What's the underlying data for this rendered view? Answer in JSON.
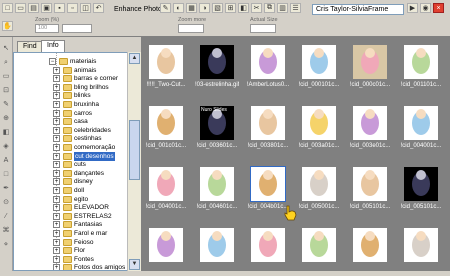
{
  "toolbar": {
    "enhance_label": "Enhance Photo",
    "browser_combo_value": "Cris Taylor-SilviaFrame",
    "zoom_group_label": "Zoom (%)",
    "zoom_value": "100",
    "actual_size_label": "Actual Size",
    "zoom_more_label": "Zoom more"
  },
  "sidebar": {
    "tabs": [
      "Find",
      "Info"
    ],
    "active_tab": "Info",
    "folders": [
      {
        "label": "materiais",
        "expanded": true,
        "selected": false
      },
      {
        "label": "animais",
        "expanded": false,
        "selected": false
      },
      {
        "label": "barras e corner",
        "expanded": false,
        "selected": false
      },
      {
        "label": "bling brilhos",
        "expanded": false,
        "selected": false
      },
      {
        "label": "blinks",
        "expanded": false,
        "selected": false
      },
      {
        "label": "bruxinha",
        "expanded": false,
        "selected": false
      },
      {
        "label": "carros",
        "expanded": false,
        "selected": false
      },
      {
        "label": "casa",
        "expanded": false,
        "selected": false
      },
      {
        "label": "celebridades",
        "expanded": false,
        "selected": false
      },
      {
        "label": "cestinhas",
        "expanded": false,
        "selected": false
      },
      {
        "label": "comemoração",
        "expanded": false,
        "selected": false
      },
      {
        "label": "cut desenhos",
        "expanded": false,
        "selected": true
      },
      {
        "label": "cuts",
        "expanded": false,
        "selected": false
      },
      {
        "label": "dançantes",
        "expanded": false,
        "selected": false
      },
      {
        "label": "disney",
        "expanded": false,
        "selected": false
      },
      {
        "label": "doll",
        "expanded": false,
        "selected": false
      },
      {
        "label": "egito",
        "expanded": false,
        "selected": false
      },
      {
        "label": "ELEVADOR",
        "expanded": false,
        "selected": false
      },
      {
        "label": "ESTRELAS2",
        "expanded": false,
        "selected": false
      },
      {
        "label": "Fantasias",
        "expanded": false,
        "selected": false
      },
      {
        "label": "Farol e mar",
        "expanded": false,
        "selected": false
      },
      {
        "label": "Feioso",
        "expanded": false,
        "selected": false
      },
      {
        "label": "Flor",
        "expanded": false,
        "selected": false
      },
      {
        "label": "Fontes",
        "expanded": false,
        "selected": false
      },
      {
        "label": "Fotos dos amigos",
        "expanded": false,
        "selected": false
      }
    ]
  },
  "gallery": {
    "items": [
      {
        "caption": "!!!!!_Two-Cut...",
        "tone": "light"
      },
      {
        "caption": "!03-estrelinha.gif",
        "tone": "dark"
      },
      {
        "caption": "!AmberLotus0...",
        "tone": "light"
      },
      {
        "caption": "!cid_000101c...",
        "tone": "light"
      },
      {
        "caption": "!cid_000c01c...",
        "tone": "tan"
      },
      {
        "caption": "!cid_001101c...",
        "tone": "light"
      },
      {
        "caption": "!cid_001c01c...",
        "tone": "light"
      },
      {
        "caption": "!cid_003601c...",
        "tone": "dark"
      },
      {
        "caption": "!cid_003801c...",
        "tone": "light"
      },
      {
        "caption": "!cid_003a01c...",
        "tone": "light"
      },
      {
        "caption": "!cid_003e01c...",
        "tone": "light"
      },
      {
        "caption": "!cid_004001c...",
        "tone": "light"
      },
      {
        "caption": "!cid_004001c...",
        "tone": "light"
      },
      {
        "caption": "!cid_004601c...",
        "tone": "light"
      },
      {
        "caption": "!cid_004b01c...",
        "tone": "light"
      },
      {
        "caption": "!cid_005001c...",
        "tone": "light"
      },
      {
        "caption": "!cid_005101c...",
        "tone": "light"
      },
      {
        "caption": "!cid_005101c...",
        "tone": "dark"
      },
      {
        "caption": "",
        "tone": "light"
      },
      {
        "caption": "",
        "tone": "light"
      },
      {
        "caption": "",
        "tone": "light"
      },
      {
        "caption": "",
        "tone": "light"
      },
      {
        "caption": "",
        "tone": "light"
      },
      {
        "caption": "",
        "tone": "light"
      }
    ]
  },
  "thumb_label": "Nuro Slides"
}
